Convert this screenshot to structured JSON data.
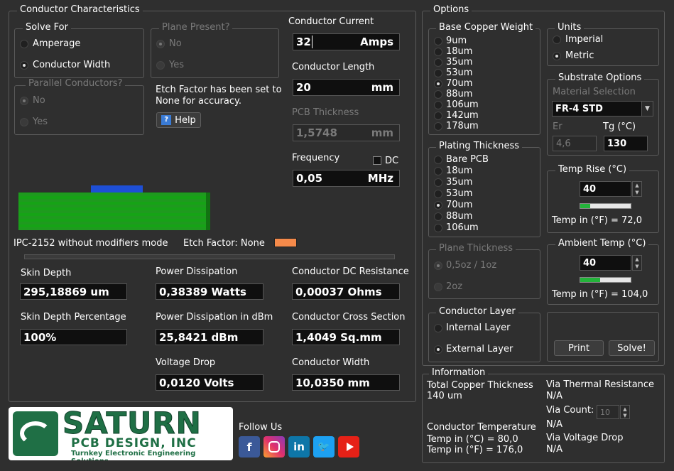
{
  "conductor_characteristics": {
    "title": "Conductor Characteristics",
    "solve_for": {
      "title": "Solve For",
      "options": [
        "Amperage",
        "Conductor Width"
      ],
      "selected": "Conductor Width"
    },
    "plane_present": {
      "title": "Plane Present?",
      "options": [
        "No",
        "Yes"
      ]
    },
    "parallel_conductors": {
      "title": "Parallel Conductors?",
      "options": [
        "No",
        "Yes"
      ]
    },
    "etch_note": "Etch Factor has been set to None for accuracy.",
    "help_label": "Help",
    "mode_text": "IPC-2152 without modifiers mode",
    "etch_factor_label": "Etch Factor: None",
    "etch_color": "#f58a4a"
  },
  "inputs": {
    "current": {
      "label": "Conductor Current",
      "value": "32",
      "unit": "Amps"
    },
    "length": {
      "label": "Conductor Length",
      "value": "20",
      "unit": "mm"
    },
    "pcb_thickness": {
      "label": "PCB Thickness",
      "value": "1,5748",
      "unit": "mm"
    },
    "frequency": {
      "label": "Frequency",
      "value": "0,05",
      "unit": "MHz",
      "dc_label": "DC"
    }
  },
  "results": {
    "skin_depth": {
      "label": "Skin Depth",
      "value": "295,18869 um"
    },
    "skin_depth_pct": {
      "label": "Skin Depth Percentage",
      "value": "100%"
    },
    "power_dissipation": {
      "label": "Power Dissipation",
      "value": "0,38389 Watts"
    },
    "power_dbm": {
      "label": "Power Dissipation in dBm",
      "value": "25,8421 dBm"
    },
    "voltage_drop": {
      "label": "Voltage Drop",
      "value": "0,0120 Volts"
    },
    "dc_resistance": {
      "label": "Conductor DC Resistance",
      "value": "0,00037 Ohms"
    },
    "cross_section": {
      "label": "Conductor Cross Section",
      "value": "1,4049 Sq.mm"
    },
    "width": {
      "label": "Conductor Width",
      "value": "10,0350 mm"
    }
  },
  "options": {
    "title": "Options",
    "base_copper": {
      "title": "Base Copper Weight",
      "options": [
        "9um",
        "18um",
        "35um",
        "53um",
        "70um",
        "88um",
        "106um",
        "142um",
        "178um"
      ],
      "selected": "70um"
    },
    "plating": {
      "title": "Plating Thickness",
      "options": [
        "Bare PCB",
        "18um",
        "35um",
        "53um",
        "70um",
        "88um",
        "106um"
      ],
      "selected": "70um"
    },
    "plane_thickness": {
      "title": "Plane Thickness",
      "options": [
        "0,5oz / 1oz",
        "2oz"
      ]
    },
    "conductor_layer": {
      "title": "Conductor Layer",
      "options": [
        "Internal Layer",
        "External Layer"
      ],
      "selected": "External Layer"
    },
    "units": {
      "title": "Units",
      "options": [
        "Imperial",
        "Metric"
      ],
      "selected": "Metric"
    },
    "substrate": {
      "title": "Substrate Options",
      "material_label": "Material Selection",
      "material": "FR-4 STD",
      "er_label": "Er",
      "er": "4,6",
      "tg_label": "Tg (°C)",
      "tg": "130"
    },
    "temp_rise": {
      "title": "Temp Rise (°C)",
      "value": "40",
      "fahrenheit": "Temp in (°F) = 72,0",
      "level": 0.2
    },
    "ambient": {
      "title": "Ambient Temp (°C)",
      "value": "40",
      "fahrenheit": "Temp in (°F) = 104,0",
      "level": 0.4
    },
    "print_label": "Print",
    "solve_label": "Solve!"
  },
  "information": {
    "title": "Information",
    "total_copper_label": "Total Copper Thickness",
    "total_copper": "140 um",
    "conductor_temp_label": "Conductor Temperature",
    "temp_c": "Temp in (°C) = 80,0",
    "temp_f": "Temp in (°F) = 176,0",
    "via_thermal_label": "Via Thermal Resistance",
    "via_thermal": "N/A",
    "via_count_label": "Via Count:",
    "via_count": "10",
    "via_count_value": "N/A",
    "via_voltage_label": "Via Voltage Drop",
    "via_voltage": "N/A"
  },
  "branding": {
    "logo_main": "SATURN",
    "logo_sub": "PCB DESIGN, INC",
    "tagline": "Turnkey Electronic Engineering Solutions",
    "follow": "Follow Us",
    "social": [
      "facebook-icon",
      "instagram-icon",
      "linkedin-icon",
      "twitter-icon",
      "youtube-icon"
    ]
  }
}
